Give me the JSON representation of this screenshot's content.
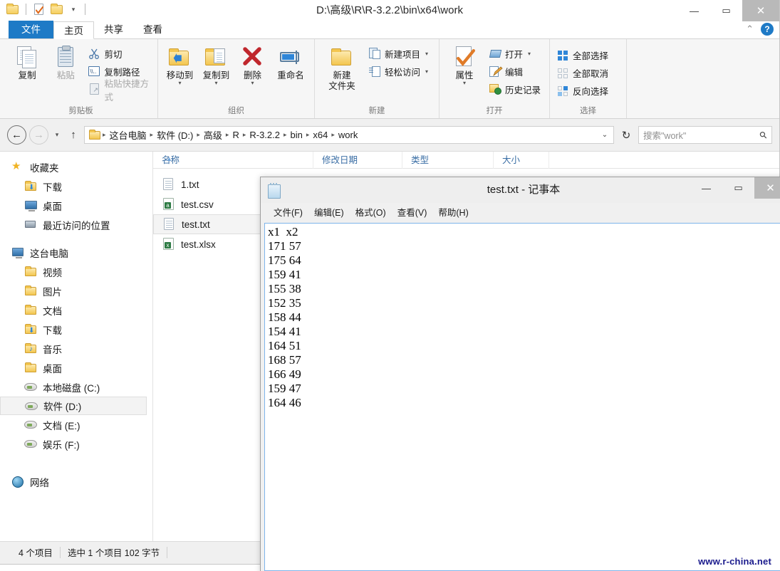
{
  "explorer": {
    "title": "D:\\高级\\R\\R-3.2.2\\bin\\x64\\work",
    "window_buttons": {
      "minimize": "—",
      "maximize": "▭",
      "close": "✕"
    },
    "quick_access": {
      "folder_icon": "folder-icon",
      "new_folder_icon": "new-folder-icon",
      "properties_icon": "properties-icon",
      "dropdown": "▾"
    },
    "tabs": [
      {
        "label": "文件",
        "kind": "file"
      },
      {
        "label": "主页",
        "kind": "active"
      },
      {
        "label": "共享",
        "kind": "normal"
      },
      {
        "label": "查看",
        "kind": "normal"
      }
    ],
    "tab_right": {
      "collapse": "⌃",
      "help": "?"
    },
    "ribbon": {
      "groups": [
        {
          "label": "剪贴板",
          "big": [
            {
              "label": "复制",
              "icon": "copy-icon",
              "disabled": false
            },
            {
              "label": "粘贴",
              "icon": "paste-icon",
              "disabled": true
            }
          ],
          "small": [
            {
              "label": "剪切",
              "icon": "scissors-icon",
              "disabled": false
            },
            {
              "label": "复制路径",
              "icon": "copy-path-icon",
              "disabled": false
            },
            {
              "label": "粘贴快捷方式",
              "icon": "paste-shortcut-icon",
              "disabled": true
            }
          ]
        },
        {
          "label": "组织",
          "big": [
            {
              "label": "移动到",
              "icon": "move-to-icon",
              "caret": "▾"
            },
            {
              "label": "复制到",
              "icon": "copy-to-icon",
              "caret": "▾"
            },
            {
              "label": "删除",
              "icon": "delete-icon",
              "caret": "▾"
            },
            {
              "label": "重命名",
              "icon": "rename-icon"
            }
          ],
          "small": []
        },
        {
          "label": "新建",
          "big": [
            {
              "label": "新建\n文件夹",
              "icon": "new-folder-icon"
            }
          ],
          "small": [
            {
              "label": "新建项目",
              "icon": "new-item-icon",
              "caret": "▾"
            },
            {
              "label": "轻松访问",
              "icon": "easy-access-icon",
              "caret": "▾"
            }
          ]
        },
        {
          "label": "打开",
          "big": [
            {
              "label": "属性",
              "icon": "properties-icon",
              "caret": "▾"
            }
          ],
          "small": [
            {
              "label": "打开",
              "icon": "open-icon",
              "caret": "▾"
            },
            {
              "label": "编辑",
              "icon": "edit-icon"
            },
            {
              "label": "历史记录",
              "icon": "history-icon"
            }
          ]
        },
        {
          "label": "选择",
          "big": [],
          "small": [
            {
              "label": "全部选择",
              "icon": "select-all-icon"
            },
            {
              "label": "全部取消",
              "icon": "select-none-icon"
            },
            {
              "label": "反向选择",
              "icon": "invert-selection-icon"
            }
          ]
        }
      ]
    },
    "address": {
      "back": "←",
      "forward": "→",
      "recent_dropdown": "▾",
      "up": "↑",
      "crumbs": [
        "这台电脑",
        "软件 (D:)",
        "高级",
        "R",
        "R-3.2.2",
        "bin",
        "x64",
        "work"
      ],
      "crumb_sep": "▸",
      "path_chevron": "⌄",
      "refresh": "↻"
    },
    "search": {
      "placeholder": "搜索\"work\"",
      "icon": "search-icon"
    },
    "nav_pane": {
      "sections": [
        {
          "header": {
            "label": "收藏夹",
            "icon": "star-icon"
          },
          "items": [
            {
              "label": "下载",
              "icon": "download-folder-icon"
            },
            {
              "label": "桌面",
              "icon": "desktop-icon"
            },
            {
              "label": "最近访问的位置",
              "icon": "recent-places-icon"
            }
          ]
        },
        {
          "header": {
            "label": "这台电脑",
            "icon": "computer-icon"
          },
          "items": [
            {
              "label": "视频",
              "icon": "videos-folder-icon"
            },
            {
              "label": "图片",
              "icon": "pictures-folder-icon"
            },
            {
              "label": "文档",
              "icon": "documents-folder-icon"
            },
            {
              "label": "下载",
              "icon": "download-folder-icon"
            },
            {
              "label": "音乐",
              "icon": "music-folder-icon"
            },
            {
              "label": "桌面",
              "icon": "desktop-folder-icon"
            },
            {
              "label": "本地磁盘 (C:)",
              "icon": "drive-icon"
            },
            {
              "label": "软件 (D:)",
              "icon": "drive-icon",
              "selected": true
            },
            {
              "label": "文档 (E:)",
              "icon": "drive-icon"
            },
            {
              "label": "娱乐 (F:)",
              "icon": "drive-icon"
            }
          ]
        },
        {
          "header": {
            "label": "网络",
            "icon": "network-icon"
          },
          "items": []
        }
      ]
    },
    "file_list": {
      "columns": [
        {
          "label": "名称",
          "sort": "▲"
        },
        {
          "label": "修改日期"
        },
        {
          "label": "类型"
        },
        {
          "label": "大小"
        }
      ],
      "rows": [
        {
          "name": "1.txt",
          "icon": "text-file-icon",
          "selected": false
        },
        {
          "name": "test.csv",
          "icon": "csv-file-icon",
          "selected": false
        },
        {
          "name": "test.txt",
          "icon": "text-file-icon",
          "selected": true
        },
        {
          "name": "test.xlsx",
          "icon": "excel-file-icon",
          "selected": false
        }
      ]
    },
    "status_bar": {
      "item_count": "4 个项目",
      "selection": "选中 1 个项目  102 字节"
    }
  },
  "notepad": {
    "title": "test.txt - 记事本",
    "icon": "notepad-icon",
    "window_buttons": {
      "minimize": "—",
      "maximize": "▭",
      "close": "✕"
    },
    "menu": [
      "文件(F)",
      "编辑(E)",
      "格式(O)",
      "查看(V)",
      "帮助(H)"
    ],
    "content": "x1  x2\n171 57\n175 64\n159 41\n155 38\n152 35\n158 44\n154 41\n164 51\n168 57\n166 49\n159 47\n164 46"
  },
  "watermark": "www.r-china.net"
}
